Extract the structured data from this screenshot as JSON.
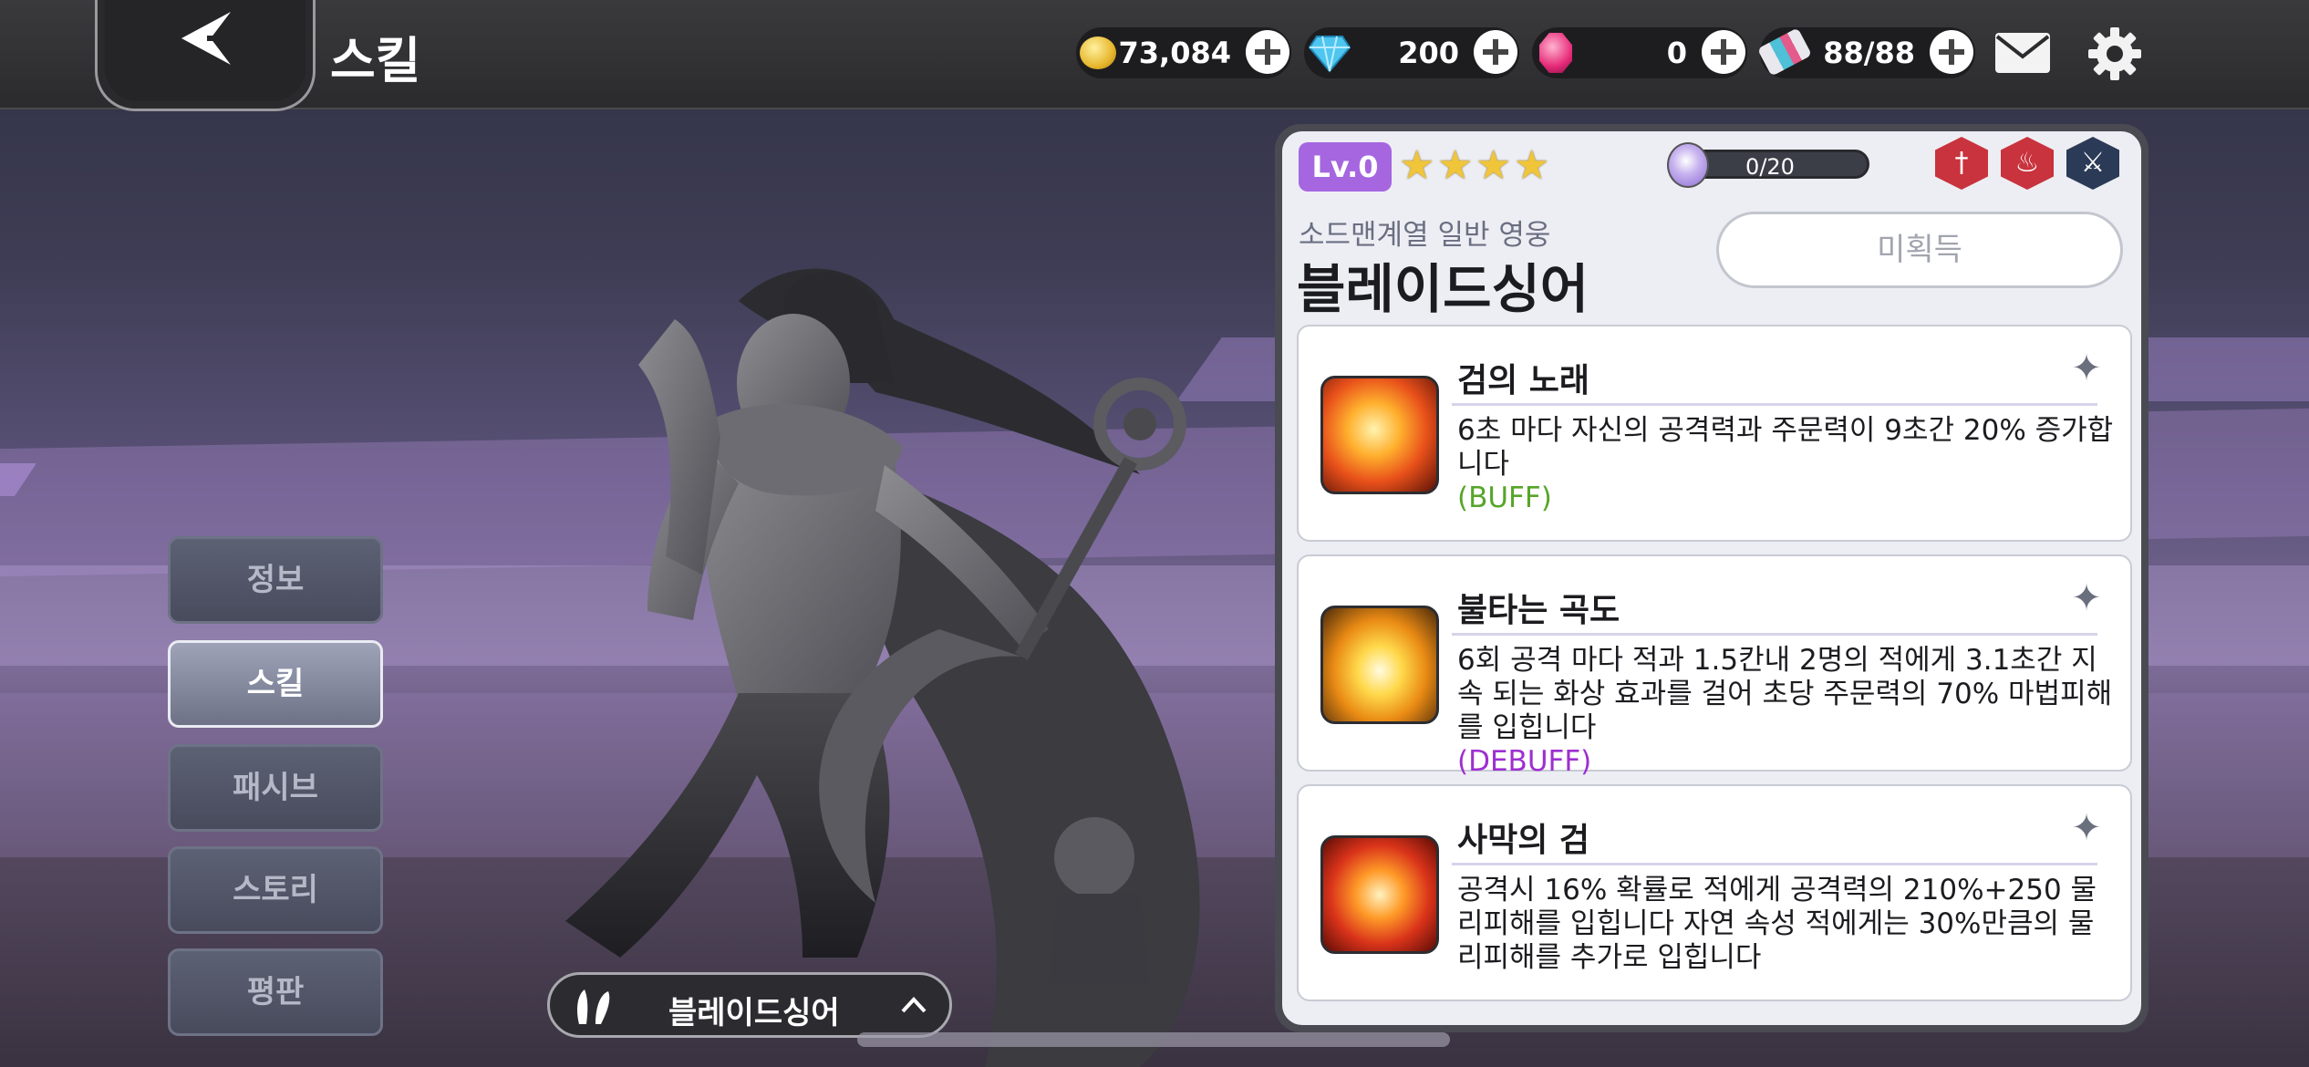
{
  "header": {
    "title": "스킬",
    "currencies": [
      {
        "name": "gold",
        "value": "73,084"
      },
      {
        "name": "diamond",
        "value": "200"
      },
      {
        "name": "ruby",
        "value": "0"
      },
      {
        "name": "stamina",
        "value": "88/88"
      }
    ]
  },
  "nav": {
    "items": [
      {
        "label": "정보",
        "active": false
      },
      {
        "label": "스킬",
        "active": true
      },
      {
        "label": "패시브",
        "active": false
      },
      {
        "label": "스토리",
        "active": false
      },
      {
        "label": "평판",
        "active": false
      }
    ]
  },
  "hero_selector": {
    "name": "블레이드싱어"
  },
  "hero": {
    "level": "Lv.0",
    "stars": 4,
    "essence": "0/20",
    "subtitle": "소드맨계열 일반 영웅",
    "name": "블레이드싱어",
    "status": "미획득"
  },
  "skills": [
    {
      "title": "검의 노래",
      "desc": "6초 마다 자신의 공격력과 주문력이 9초간 20% 증가합니다",
      "tag": "(BUFF)",
      "tag_type": "buff"
    },
    {
      "title": "불타는 곡도",
      "desc": "6회 공격 마다 적과 1.5칸내 2명의 적에게 3.1초간 지속 되는 화상 효과를 걸어 초당 주문력의 70% 마법피해를 입힙니다",
      "tag": "(DEBUFF)",
      "tag_type": "debuff"
    },
    {
      "title": "사막의 검",
      "desc": "공격시 16% 확률로 적에게 공격력의 210%+250 물리피해를 입힙니다 자연 속성 적에게는 30%만큼의 물리피해를 추가로 입힙니다",
      "tag": "",
      "tag_type": ""
    }
  ],
  "colors": {
    "level_badge": "#a566e0",
    "buff": "#57a52a",
    "debuff": "#9d2fd0",
    "star": "#f0c53a"
  }
}
